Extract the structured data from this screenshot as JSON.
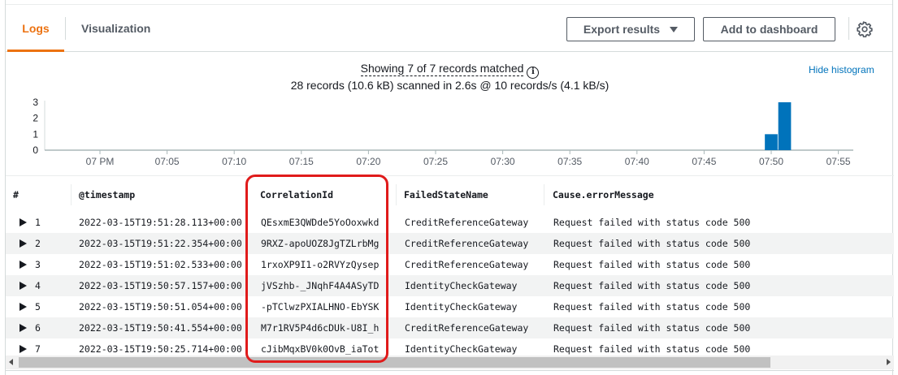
{
  "tabs": {
    "logs": "Logs",
    "visualization": "Visualization"
  },
  "toolbar": {
    "export_label": "Export results",
    "add_label": "Add to dashboard"
  },
  "histogram": {
    "summary": "Showing 7 of 7 records matched",
    "scanned": "28 records (10.6 kB) scanned in 2.6s @ 10 records/s (4.1 kB/s)",
    "hide_label": "Hide histogram",
    "bar_color": "#0073bb"
  },
  "chart_data": {
    "type": "bar",
    "x_ticks": [
      "07 PM",
      "07:05",
      "07:10",
      "07:15",
      "07:20",
      "07:25",
      "07:30",
      "07:35",
      "07:40",
      "07:45",
      "07:50",
      "07:55"
    ],
    "y_ticks": [
      0,
      1,
      2,
      3
    ],
    "ylim": [
      0,
      3
    ],
    "series": [
      {
        "x": [
          "07:50",
          "07:51"
        ],
        "values": [
          1,
          3
        ]
      }
    ]
  },
  "table": {
    "columns": [
      "#",
      "@timestamp",
      "CorrelationId",
      "FailedStateName",
      "Cause.errorMessage"
    ],
    "rows": [
      [
        "1",
        "2022-03-15T19:51:28.113+00:00",
        "QEsxmE3QWDde5YoOoxwkd",
        "CreditReferenceGateway",
        "Request failed with status code 500"
      ],
      [
        "2",
        "2022-03-15T19:51:22.354+00:00",
        "9RXZ-apoUOZ8JgTZLrbMg",
        "CreditReferenceGateway",
        "Request failed with status code 500"
      ],
      [
        "3",
        "2022-03-15T19:51:02.533+00:00",
        "1rxoXP9I1-o2RVYzQysep",
        "CreditReferenceGateway",
        "Request failed with status code 500"
      ],
      [
        "4",
        "2022-03-15T19:50:57.157+00:00",
        "jVSzhb-_JNqhF4A4ASyTD",
        "IdentityCheckGateway",
        "Request failed with status code 500"
      ],
      [
        "5",
        "2022-03-15T19:50:51.054+00:00",
        "-pTClwzPXIALHNO-EbYSK",
        "IdentityCheckGateway",
        "Request failed with status code 500"
      ],
      [
        "6",
        "2022-03-15T19:50:41.554+00:00",
        "M7r1RV5P4d6cDUk-U8I_h",
        "CreditReferenceGateway",
        "Request failed with status code 500"
      ],
      [
        "7",
        "2022-03-15T19:50:25.714+00:00",
        "cJibMqxBV0k0OvB_iaTot",
        "IdentityCheckGateway",
        "Request failed with status code 500"
      ]
    ]
  },
  "colors": {
    "accent": "#ec7211",
    "link": "#0073bb",
    "highlight": "#e01b1b"
  }
}
